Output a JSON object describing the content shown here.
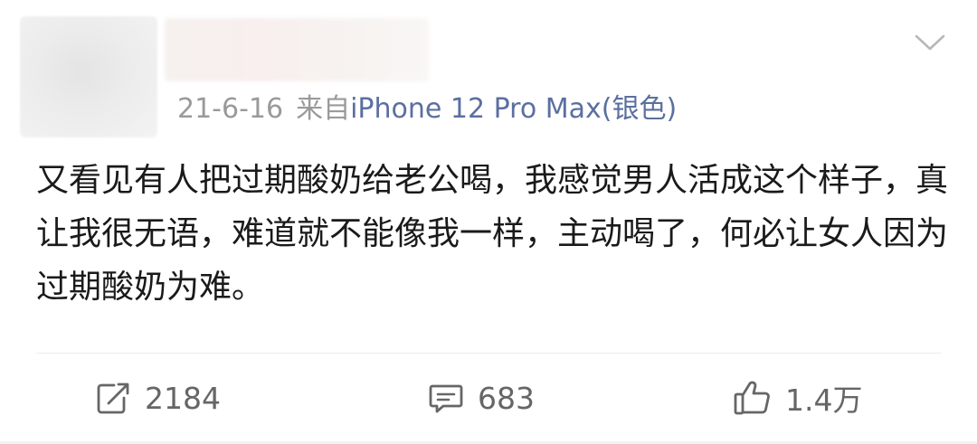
{
  "post": {
    "date": "21-6-16",
    "source_prefix": "来自",
    "source_device": "iPhone 12 Pro Max(银色)",
    "content": "又看见有人把过期酸奶给老公喝，我感觉男人活成这个样子，真让我很无语，难道就不能像我一样，主动喝了，何必让女人因为过期酸奶为难。"
  },
  "actions": {
    "repost_count": "2184",
    "comment_count": "683",
    "like_count": "1.4万"
  },
  "colors": {
    "text": "#1a1a1a",
    "meta": "#9a9a9a",
    "link": "#5b6fa0",
    "icon": "#666666"
  }
}
